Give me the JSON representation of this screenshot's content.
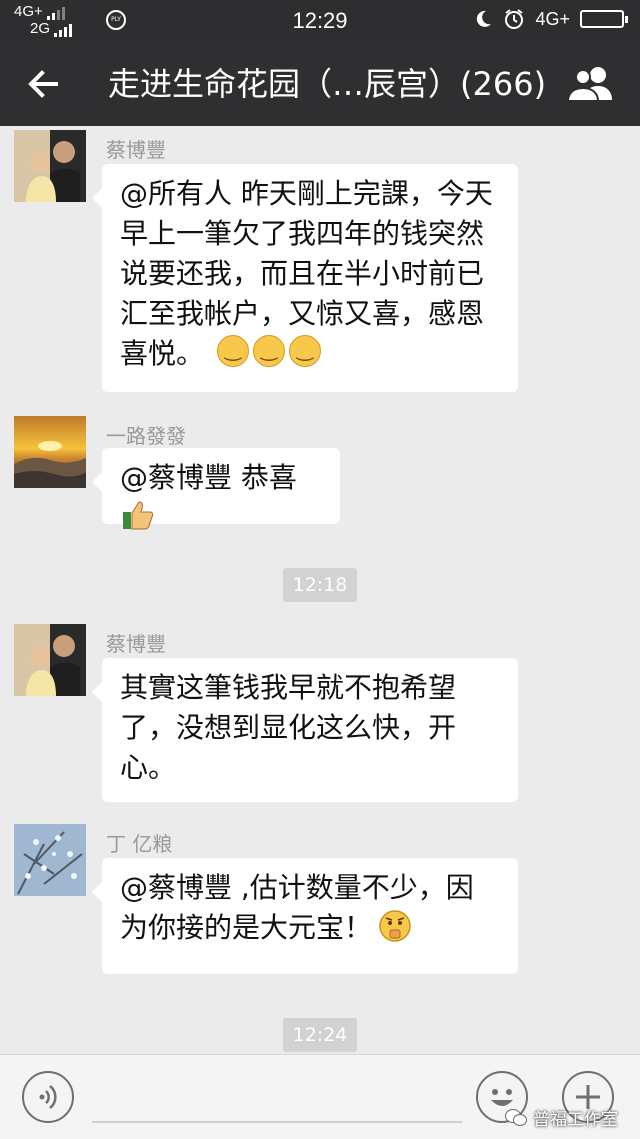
{
  "status_bar": {
    "network_top": "4G+",
    "network_bottom": "2G",
    "time": "12:29",
    "network_right": "4G+"
  },
  "header": {
    "title": "走进生命花园（…辰宫）(266)"
  },
  "messages": [
    {
      "sender": "蔡博豐",
      "text": "@所有人 昨天剛上完課，今天早上一筆欠了我四年的钱突然说要还我，而且在半小时前已汇至我帐户，又惊又喜，感恩喜悦。"
    },
    {
      "sender": "一路發發",
      "text": "@蔡博豐 恭喜"
    },
    {
      "timestamp": "12:18"
    },
    {
      "sender": "蔡博豐",
      "text": "其實这筆钱我早就不抱希望了，没想到显化这么快，开心。"
    },
    {
      "sender": "丁 亿粮",
      "text": "@蔡博豐 ,估计数量不少，因为你接的是大元宝！"
    },
    {
      "timestamp": "12:24"
    }
  ],
  "watermark": "普福工作室",
  "colors": {
    "header_bg": "#2f2f31",
    "chat_bg": "#ebebeb",
    "bubble_bg": "#ffffff"
  }
}
